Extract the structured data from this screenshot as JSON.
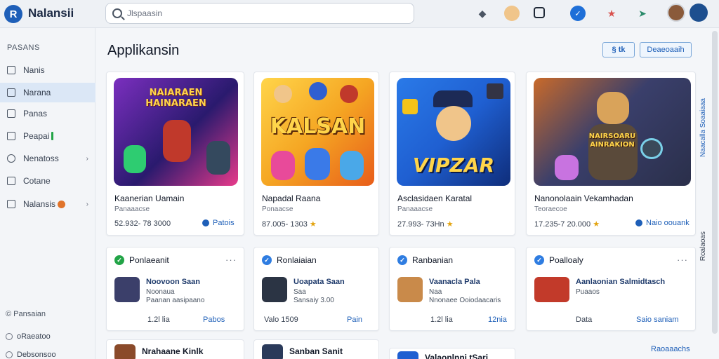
{
  "app": {
    "title": "Nalansii",
    "logo_letter": "R"
  },
  "search": {
    "placeholder": "Jlspaasin"
  },
  "sidebar": {
    "heading": "PASANS",
    "items": [
      {
        "label": "Nanis"
      },
      {
        "label": "Narana"
      },
      {
        "label": "Panas"
      },
      {
        "label": "Peapai"
      },
      {
        "label": "Nenatoss"
      },
      {
        "label": "Cotane"
      },
      {
        "label": "Nalansis"
      }
    ],
    "footer_heading": "© Pansaian",
    "footer_items": [
      {
        "label": "oRaeatoo"
      },
      {
        "label": "Debsonsoo"
      }
    ]
  },
  "main": {
    "title": "Applikansin",
    "button_small": "§ tk",
    "button_outline": "Deaeoaaih"
  },
  "games": [
    {
      "thumb_text": "NAIARAEN\nHAINARAEN",
      "name": "Kaanerian Uamain",
      "sub": "Panaaacse",
      "stats": "52.932- 78 3000",
      "action": "Patois",
      "palette": [
        "#7b2fbf",
        "#2a1a6e",
        "#e83a8a"
      ]
    },
    {
      "thumb_text": "KALSAN",
      "name": "Napadal Raana",
      "sub": "Ponaacse",
      "stats": "87.005- 1303",
      "action": "",
      "palette": [
        "#f5a623",
        "#e85d1a",
        "#ffd54a"
      ]
    },
    {
      "thumb_text": "VIPZAR",
      "name": "Asclasidaen Karatal",
      "sub": "Panaaacse",
      "stats": "27.993- 73Hn",
      "action": "",
      "palette": [
        "#1f5fd1",
        "#0f2d7a",
        "#f3c31a"
      ]
    },
    {
      "thumb_text": "NAIRSOARU\nAINRAKION",
      "name": "Nanonolaain Vekamhadan",
      "sub": "Teoraecoe",
      "stats": "17.235-7 20.000",
      "action": "Naio oouank",
      "palette": [
        "#3a3f6b",
        "#c96a2a",
        "#2a2f4a"
      ]
    }
  ],
  "feed": [
    {
      "head": "Ponlaeanit",
      "check_color": "#22a447",
      "title": "Noovoon Saan",
      "l1": "Noonaua",
      "l2": "Paanan aasipaano",
      "stats": "1.2l lia",
      "action": "Pabos",
      "thumb_color": "#3b3f6a"
    },
    {
      "head": "Ronlaiaian",
      "check_color": "#2f7de1",
      "title": "Uoapata Saan",
      "l1": "Saa",
      "l2": "Sansaiy 3.00",
      "stats": "Valo 1509",
      "action": "Pain",
      "thumb_color": "#2b3444"
    },
    {
      "head": "Ranbanian",
      "check_color": "#2f7de1",
      "title": "Vaanacla Pala",
      "l1": "Naa",
      "l2": "Nnonaee Ooiodaacaris",
      "stats": "1.2l lia",
      "action": "12nia",
      "thumb_color": "#c98a4a"
    },
    {
      "head": "Poalloaly",
      "check_color": "#2f7de1",
      "title": "Aanlaonian Salmidtasch",
      "l1": "Puaaos",
      "l2": "",
      "stats": "Data",
      "action": "Saio saniam",
      "thumb_color": "#c23a2a"
    }
  ],
  "stubs": [
    {
      "title": "Nrahaane Kinlk",
      "thumb_color": "#8a4a2a"
    },
    {
      "title": "Sanban Sanit",
      "thumb_color": "#2a3a5a"
    },
    {
      "title": "Valaonlnni tSari",
      "thumb_color": "#1f5fd1"
    }
  ],
  "right_rail": {
    "top": "Naacalla Soaaiaaa",
    "bottom": "Roalaoas"
  },
  "footer_link": "Raoaaachs",
  "colors": {
    "accent": "#1e5fb8",
    "active_nav": "#dbe7f6",
    "green": "#22a447"
  }
}
